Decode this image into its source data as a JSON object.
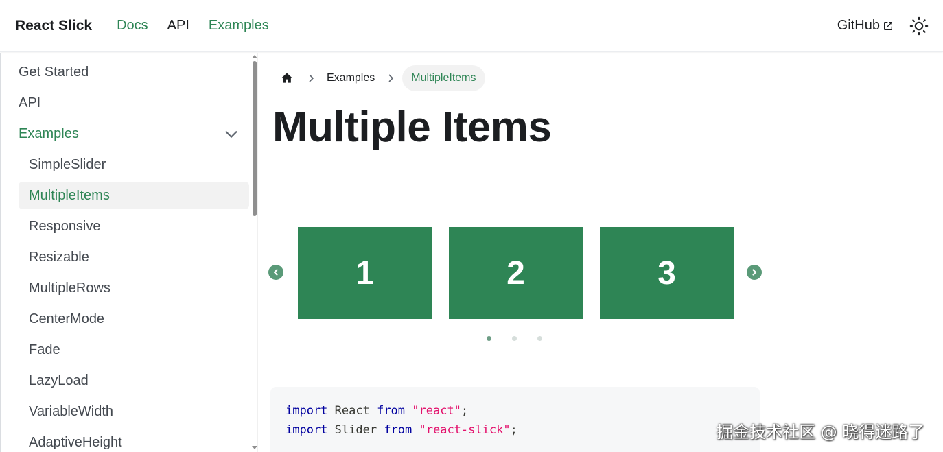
{
  "navbar": {
    "brand": "React Slick",
    "links": [
      "Docs",
      "API",
      "Examples"
    ],
    "github": "GitHub",
    "theme_icon": "sun-icon"
  },
  "sidebar": {
    "items": [
      "Get Started",
      "API",
      "Examples"
    ],
    "sub_items": [
      "SimpleSlider",
      "MultipleItems",
      "Responsive",
      "Resizable",
      "MultipleRows",
      "CenterMode",
      "Fade",
      "LazyLoad",
      "VariableWidth",
      "AdaptiveHeight"
    ],
    "active": "MultipleItems"
  },
  "breadcrumb": {
    "home_icon": "home-icon",
    "items": [
      "Examples",
      "MultipleItems"
    ]
  },
  "page": {
    "title": "Multiple Items"
  },
  "slider": {
    "slides": [
      "1",
      "2",
      "3"
    ],
    "dots": 3,
    "active_dot": 0,
    "accent": "#2e8555"
  },
  "code": {
    "line1": {
      "kw1": "import",
      "name": " React ",
      "kw2": "from",
      "str": " \"react\"",
      "end": ";"
    },
    "line2": {
      "kw1": "import",
      "name": " Slider ",
      "kw2": "from",
      "str": " \"react-slick\"",
      "end": ";"
    }
  },
  "watermark": "掘金技术社区 @ 晓得迷路了"
}
